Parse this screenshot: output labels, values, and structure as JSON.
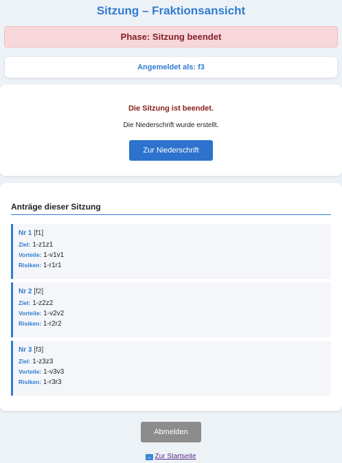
{
  "page": {
    "title": "Sitzung – Fraktionsansicht"
  },
  "phase_banner": {
    "text": "Phase: Sitzung beendet"
  },
  "login": {
    "text": "Angemeldet als: f3"
  },
  "session_ended": {
    "title": "Die Sitzung ist beendet.",
    "subtitle": "Die Niederschrift wurde erstellt.",
    "button_label": "Zur Niederschrift"
  },
  "motions": {
    "heading": "Anträge dieser Sitzung",
    "labels": {
      "goal": "Ziel:",
      "advantages": "Vorteile:",
      "risks": "Risiken:"
    },
    "items": [
      {
        "nr": "Nr 1",
        "faction": "[f1]",
        "goal": "1-z1z1",
        "advantages": "1-v1v1",
        "risks": "1-r1r1"
      },
      {
        "nr": "Nr 2",
        "faction": "[f2]",
        "goal": "1-z2z2",
        "advantages": "1-v2v2",
        "risks": "1-r2r2"
      },
      {
        "nr": "Nr 3",
        "faction": "[f3]",
        "goal": "1-z3z3",
        "advantages": "1-v3v3",
        "risks": "1-r3r3"
      }
    ]
  },
  "footer": {
    "logout_label": "Abmelden",
    "home_icon": "back-arrow-icon",
    "home_link": "Zur Startseite"
  },
  "colors": {
    "accent": "#2f7bcf",
    "primary_button": "#2d72cc",
    "danger_bg": "#f8d7da",
    "danger_text": "#842029",
    "logout_button": "#8c8c8c"
  }
}
